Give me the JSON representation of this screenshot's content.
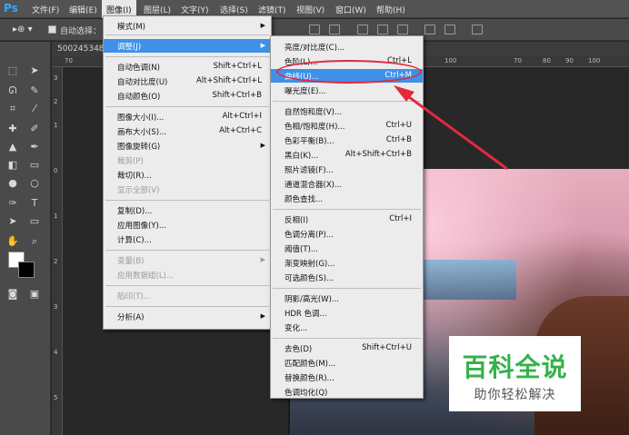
{
  "menubar": {
    "logo": "Ps",
    "items": [
      "文件(F)",
      "编辑(E)",
      "图像(I)",
      "图层(L)",
      "文字(Y)",
      "选择(S)",
      "滤镜(T)",
      "视图(V)",
      "窗口(W)",
      "帮助(H)"
    ]
  },
  "optionsbar": {
    "auto_select_label": "自动选择："
  },
  "document": {
    "tab_text": "500245348",
    "ruler_h": [
      "70",
      "60",
      "100",
      "110",
      "120",
      "70",
      "80",
      "90",
      "100"
    ],
    "ruler_v": [
      "3",
      "2",
      "1",
      "0",
      "1",
      "2",
      "3",
      "4",
      "5"
    ]
  },
  "image_menu": {
    "items": [
      {
        "label": "模式(M)",
        "shortcut": "",
        "submenu": true
      },
      {
        "label": "调整(J)",
        "shortcut": "",
        "submenu": true,
        "highlighted": true
      },
      {
        "label": "自动色调(N)",
        "shortcut": "Shift+Ctrl+L"
      },
      {
        "label": "自动对比度(U)",
        "shortcut": "Alt+Shift+Ctrl+L"
      },
      {
        "label": "自动颜色(O)",
        "shortcut": "Shift+Ctrl+B"
      },
      {
        "label": "图像大小(I)...",
        "shortcut": "Alt+Ctrl+I"
      },
      {
        "label": "画布大小(S)...",
        "shortcut": "Alt+Ctrl+C"
      },
      {
        "label": "图像旋转(G)",
        "shortcut": "",
        "submenu": true
      },
      {
        "label": "裁剪(P)",
        "shortcut": "",
        "disabled": true
      },
      {
        "label": "裁切(R)...",
        "shortcut": ""
      },
      {
        "label": "显示全部(V)",
        "shortcut": "",
        "disabled": true
      },
      {
        "label": "复制(D)...",
        "shortcut": ""
      },
      {
        "label": "应用图像(Y)...",
        "shortcut": ""
      },
      {
        "label": "计算(C)...",
        "shortcut": ""
      },
      {
        "label": "变量(B)",
        "shortcut": "",
        "submenu": true,
        "disabled": true
      },
      {
        "label": "应用数据组(L)...",
        "shortcut": "",
        "disabled": true
      },
      {
        "label": "陷印(T)...",
        "shortcut": "",
        "disabled": true
      },
      {
        "label": "分析(A)",
        "shortcut": "",
        "submenu": true
      }
    ]
  },
  "adjust_menu": {
    "items": [
      {
        "label": "亮度/对比度(C)...",
        "shortcut": ""
      },
      {
        "label": "色阶(L)...",
        "shortcut": "Ctrl+L"
      },
      {
        "label": "曲线(U)...",
        "shortcut": "Ctrl+M",
        "highlighted": true
      },
      {
        "label": "曝光度(E)...",
        "shortcut": ""
      },
      {
        "label": "自然饱和度(V)...",
        "shortcut": ""
      },
      {
        "label": "色相/饱和度(H)...",
        "shortcut": "Ctrl+U"
      },
      {
        "label": "色彩平衡(B)...",
        "shortcut": "Ctrl+B"
      },
      {
        "label": "黑白(K)...",
        "shortcut": "Alt+Shift+Ctrl+B"
      },
      {
        "label": "照片滤镜(F)...",
        "shortcut": ""
      },
      {
        "label": "通道混合器(X)...",
        "shortcut": ""
      },
      {
        "label": "颜色查找...",
        "shortcut": ""
      },
      {
        "label": "反相(I)",
        "shortcut": "Ctrl+I"
      },
      {
        "label": "色调分离(P)...",
        "shortcut": ""
      },
      {
        "label": "阈值(T)...",
        "shortcut": ""
      },
      {
        "label": "渐变映射(G)...",
        "shortcut": ""
      },
      {
        "label": "可选颜色(S)...",
        "shortcut": ""
      },
      {
        "label": "阴影/高光(W)...",
        "shortcut": ""
      },
      {
        "label": "HDR 色调...",
        "shortcut": ""
      },
      {
        "label": "变化...",
        "shortcut": ""
      },
      {
        "label": "去色(D)",
        "shortcut": "Shift+Ctrl+U"
      },
      {
        "label": "匹配颜色(M)...",
        "shortcut": ""
      },
      {
        "label": "替换颜色(R)...",
        "shortcut": ""
      },
      {
        "label": "色调均化(Q)",
        "shortcut": ""
      }
    ]
  },
  "watermark": {
    "title": "百科全说",
    "subtitle": "助你轻松解决"
  },
  "colors": {
    "highlight": "#3f91e8",
    "annotation": "#e22a3c",
    "watermark_green": "#36b24a"
  }
}
